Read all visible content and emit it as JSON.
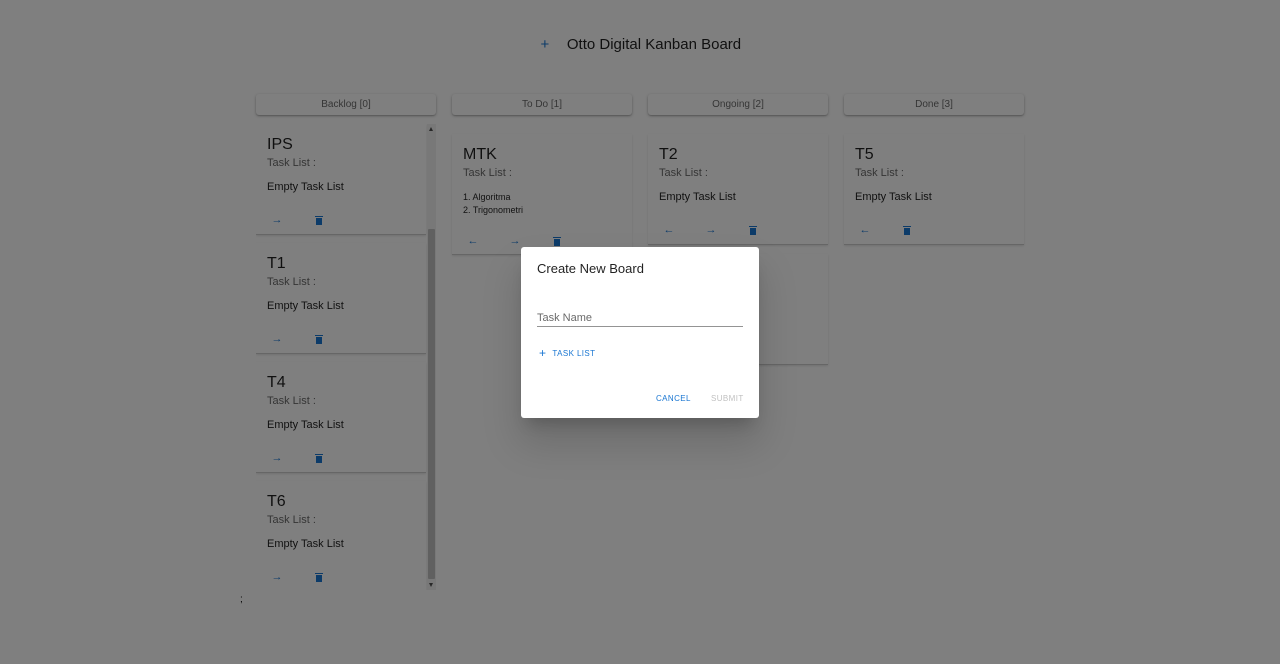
{
  "header": {
    "add_icon": "+",
    "title": "Otto Digital Kanban Board"
  },
  "columns": {
    "backlog": {
      "label": "Backlog [0]"
    },
    "todo": {
      "label": "To Do [1]"
    },
    "ongoing": {
      "label": "Ongoing [2]"
    },
    "done": {
      "label": "Done [3]"
    }
  },
  "common": {
    "task_list_label": "Task List :",
    "empty_task_list": "Empty Task List",
    "arrow_right": "→",
    "arrow_left": "←"
  },
  "cards": {
    "ips": {
      "name": "IPS"
    },
    "t1": {
      "name": "T1"
    },
    "t4": {
      "name": "T4"
    },
    "t6": {
      "name": "T6"
    },
    "mtk": {
      "name": "MTK",
      "tasks": [
        "1. Algoritma",
        "2. Trigonometri"
      ]
    },
    "t2": {
      "name": "T2"
    },
    "t5": {
      "name": "T5"
    }
  },
  "stray_text": ";",
  "dialog": {
    "title": "Create New Board",
    "task_name_placeholder": "Task Name",
    "add_task_list_icon": "+",
    "add_task_list_label": "TASK LIST",
    "cancel_label": "CANCEL",
    "submit_label": "SUBMIT"
  },
  "colors": {
    "accent": "#1976d2",
    "overlay": "rgba(0,0,0,0.5)"
  }
}
